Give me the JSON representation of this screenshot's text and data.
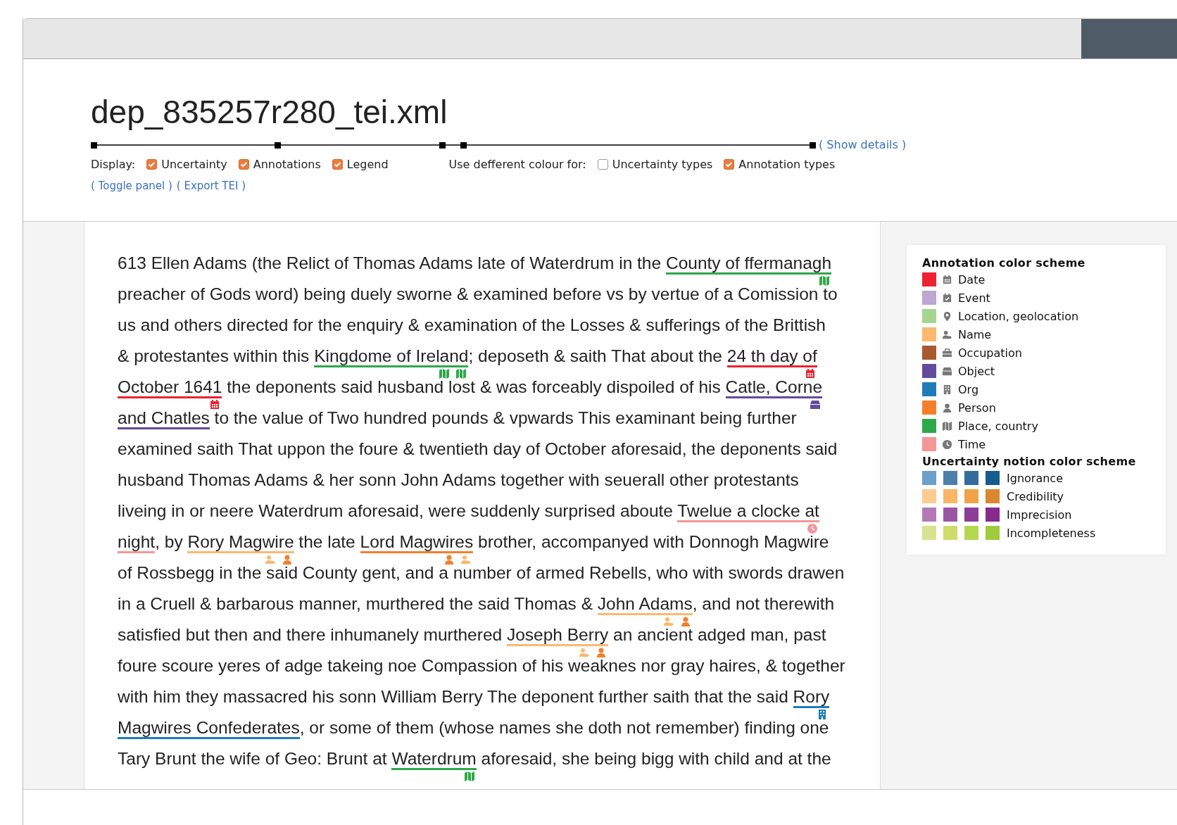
{
  "document": {
    "title": "dep_835257r280_tei.xml"
  },
  "details_link": "( Show details )",
  "display": {
    "label": "Display:",
    "options": [
      {
        "label": "Uncertainty",
        "checked": true
      },
      {
        "label": "Annotations",
        "checked": true
      },
      {
        "label": "Legend",
        "checked": true
      }
    ]
  },
  "colour_for": {
    "label": "Use defferent colour for:",
    "options": [
      {
        "label": "Uncertainty types",
        "checked": false
      },
      {
        "label": "Annotation types",
        "checked": true
      }
    ]
  },
  "links": [
    "( Toggle panel )",
    "( Export TEI )"
  ],
  "text_lines": [
    [
      {
        "text": "613 Ellen Adams (the Relict of Thomas Adams late of Waterdrum in the "
      },
      {
        "text": "County of ffermanagh",
        "annotations": [
          {
            "kind": "place",
            "icon": true
          }
        ]
      }
    ],
    [
      {
        "text": "preacher of Gods word) being duely sworne & examined before vs by vertue of a Comission to"
      }
    ],
    [
      {
        "text": "us and others directed for the enquiry & examination of the Losses & sufferings of the Brittish"
      }
    ],
    [
      {
        "text": "& protestantes within this "
      },
      {
        "text": "Kingdome of Ireland",
        "annotations": [
          {
            "kind": "place",
            "icon": true
          },
          {
            "kind": "place",
            "icon": true
          }
        ]
      },
      {
        "text": "; deposeth & saith That about the "
      },
      {
        "text": "24 th day of",
        "annotations": [
          {
            "kind": "date",
            "icon": true
          }
        ]
      }
    ],
    [
      {
        "text": "October 1641",
        "annotations": [
          {
            "kind": "date",
            "icon": true
          }
        ]
      },
      {
        "text": " the deponents said husband lost & was forceably dispoiled of his "
      },
      {
        "text": "Catle, Corne",
        "annotations": [
          {
            "kind": "object",
            "icon": true
          }
        ]
      }
    ],
    [
      {
        "text": "and Chatles",
        "annotations": [
          {
            "kind": "object",
            "icon": false
          }
        ]
      },
      {
        "text": " to the value of Two hundred pounds & vpwards This examinant being further"
      }
    ],
    [
      {
        "text": "examined saith That uppon the foure & twentieth day of October aforesaid, the deponents said"
      }
    ],
    [
      {
        "text": "husband Thomas Adams & her sonn John Adams together with seuerall other protestants"
      }
    ],
    [
      {
        "text": "liveing in or neere Waterdrum aforesaid, were suddenly surprised aboute "
      },
      {
        "text": "Twelue a clocke at",
        "annotations": [
          {
            "kind": "time",
            "icon": true
          }
        ]
      }
    ],
    [
      {
        "text": "night",
        "annotations": [
          {
            "kind": "time",
            "icon": false
          }
        ]
      },
      {
        "text": ", by "
      },
      {
        "text": "Rory Magwire",
        "annotations": [
          {
            "kind": "name",
            "icon": true
          },
          {
            "kind": "person",
            "icon": true
          }
        ]
      },
      {
        "text": " the late "
      },
      {
        "text": "Lord Magwires",
        "annotations": [
          {
            "kind": "person",
            "icon": true
          },
          {
            "kind": "name",
            "icon": true
          }
        ]
      },
      {
        "text": " brother, accompanyed with Donnogh Magwire"
      }
    ],
    [
      {
        "text": "of Rossbegg in the said County gent, and a number of armed Rebells, who with swords drawen"
      }
    ],
    [
      {
        "text": "in a Cruell & barbarous manner, murthered the said Thomas & "
      },
      {
        "text": "John Adams",
        "annotations": [
          {
            "kind": "name",
            "icon": true
          },
          {
            "kind": "person",
            "icon": true
          }
        ]
      },
      {
        "text": ", and not therewith"
      }
    ],
    [
      {
        "text": "satisfied but then and there inhumanely murthered "
      },
      {
        "text": "Joseph Berry",
        "annotations": [
          {
            "kind": "name",
            "icon": true
          },
          {
            "kind": "person",
            "icon": true
          }
        ]
      },
      {
        "text": " an ancient adged man, past"
      }
    ],
    [
      {
        "text": "foure scoure yeres of adge takeing noe Compassion of his weaknes nor gray haires, & together"
      }
    ],
    [
      {
        "text": "with him they massacred his sonn William Berry The deponent further saith that the said "
      },
      {
        "text": "Rory",
        "annotations": [
          {
            "kind": "org",
            "icon": true
          }
        ]
      }
    ],
    [
      {
        "text": "Magwires Confederates",
        "annotations": [
          {
            "kind": "org",
            "icon": false
          }
        ]
      },
      {
        "text": ", or some of them (whose names she doth not remember) finding one"
      }
    ],
    [
      {
        "text": "Tary Brunt the wife of Geo: Brunt at "
      },
      {
        "text": "Waterdrum",
        "annotations": [
          {
            "kind": "place",
            "icon": true
          }
        ]
      },
      {
        "text": " aforesaid, she being bigg with child and at the"
      }
    ]
  ],
  "legend": {
    "annotation_title": "Annotation color scheme",
    "annotation_types": [
      {
        "kind": "date",
        "label": "Date",
        "color": "#ec2330"
      },
      {
        "kind": "event",
        "label": "Event",
        "color": "#bca6d2"
      },
      {
        "kind": "location",
        "label": "Location, geolocation",
        "color": "#a5d591"
      },
      {
        "kind": "name",
        "label": "Name",
        "color": "#fbb86f"
      },
      {
        "kind": "occupation",
        "label": "Occupation",
        "color": "#a75a2e"
      },
      {
        "kind": "object",
        "label": "Object",
        "color": "#644a9c"
      },
      {
        "kind": "org",
        "label": "Org",
        "color": "#1f7cb8"
      },
      {
        "kind": "person",
        "label": "Person",
        "color": "#f37f2b"
      },
      {
        "kind": "place",
        "label": "Place, country",
        "color": "#2fa84a"
      },
      {
        "kind": "time",
        "label": "Time",
        "color": "#f49698"
      }
    ],
    "uncertainty_title": "Uncertainty notion color scheme",
    "uncertainty_types": [
      {
        "label": "Ignorance",
        "levels": [
          {
            "color": "#6c9fc9"
          },
          {
            "color": "#4d7fab"
          },
          {
            "color": "#336d9f"
          },
          {
            "color": "#165c8f"
          }
        ]
      },
      {
        "label": "Credibility",
        "levels": [
          {
            "color": "#fccb8f"
          },
          {
            "color": "#fab566"
          },
          {
            "color": "#f0a24a"
          },
          {
            "color": "#da8730"
          }
        ]
      },
      {
        "label": "Imprecision",
        "levels": [
          {
            "color": "#b479b4"
          },
          {
            "color": "#9b56a3"
          },
          {
            "color": "#8b3e96"
          },
          {
            "color": "#862a8c"
          }
        ]
      },
      {
        "label": "Incompleteness",
        "levels": [
          {
            "color": "#d8e38f"
          },
          {
            "color": "#cedd69"
          },
          {
            "color": "#b6d752"
          },
          {
            "color": "#9fcb3d"
          }
        ]
      }
    ]
  }
}
